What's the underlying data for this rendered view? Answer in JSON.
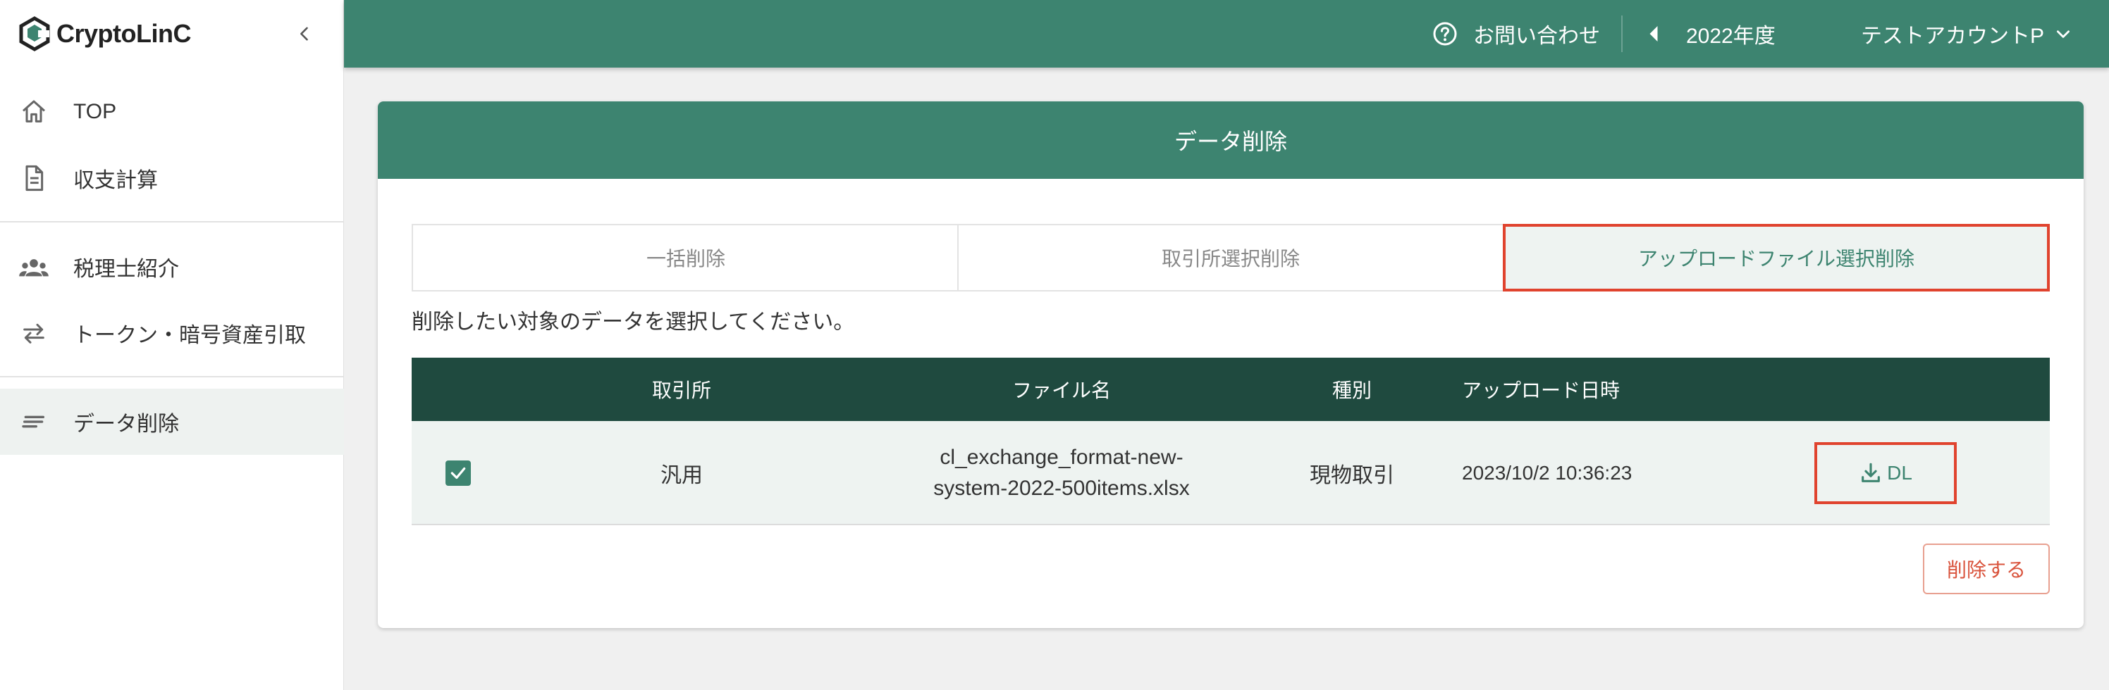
{
  "app": {
    "logo_text": "CryptoLinC"
  },
  "sidebar": {
    "items": [
      {
        "label": "TOP",
        "icon": "home-icon"
      },
      {
        "label": "収支計算",
        "icon": "document-icon"
      },
      {
        "label": "税理士紹介",
        "icon": "people-icon"
      },
      {
        "label": "トークン・暗号資産引取",
        "icon": "swap-icon"
      },
      {
        "label": "データ削除",
        "icon": "lines-icon",
        "active": true
      }
    ]
  },
  "header": {
    "contact_label": "お問い合わせ",
    "year_label": "2022年度",
    "account_label": "テストアカウントP"
  },
  "card": {
    "title": "データ削除",
    "tabs": [
      {
        "label": "一括削除"
      },
      {
        "label": "取引所選択削除"
      },
      {
        "label": "アップロードファイル選択削除",
        "active": true
      }
    ],
    "instruction": "削除したい対象のデータを選択してください。",
    "table": {
      "columns": [
        "取引所",
        "ファイル名",
        "種別",
        "アップロード日時"
      ],
      "rows": [
        {
          "checked": true,
          "exchange": "汎用",
          "file_line1": "cl_exchange_format-new-",
          "file_line2": "system-2022-500items.xlsx",
          "type": "現物取引",
          "uploaded_at": "2023/10/2 10:36:23",
          "dl_label": "DL"
        }
      ]
    },
    "delete_label": "削除する"
  },
  "colors": {
    "brand": "#3d8470",
    "table_header": "#1f4a3f",
    "highlight": "#e0432e",
    "danger": "#d9533c"
  }
}
